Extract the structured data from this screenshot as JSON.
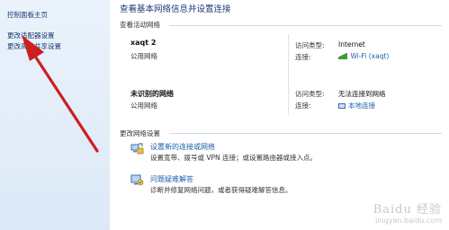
{
  "sidebar": {
    "links": [
      {
        "label": "控制面板主页"
      },
      {
        "label": "更改适配器设置"
      },
      {
        "label": "更改高级共享设置"
      }
    ]
  },
  "main": {
    "title": "查看基本网络信息并设置连接",
    "active_section_label": "查看活动网络",
    "networks": [
      {
        "name": "xaqt  2",
        "category": "公用网络",
        "access_type_label": "访问类型:",
        "access_type_value": "Internet",
        "connection_label": "连接:",
        "connection_value": "Wi-Fi (xaqt)"
      },
      {
        "name": "未识别的网络",
        "category": "公用网络",
        "access_type_label": "访问类型:",
        "access_type_value": "无法连接到网络",
        "connection_label": "连接:",
        "connection_value": "本地连接"
      }
    ],
    "change_section_label": "更改网络设置",
    "tasks": [
      {
        "link": "设置新的连接或网络",
        "description": "设置宽带、拨号或 VPN 连接；或设置路由器或接入点。"
      },
      {
        "link": "问题疑难解答",
        "description": "诊断并修复网络问题，或者获得疑难解答信息。"
      }
    ]
  },
  "watermark": {
    "top": "Baidu 经验",
    "bottom": "jingyan.baidu.com"
  },
  "colors": {
    "sidebar_bg": "#e3edf8",
    "link": "#1b5ea8",
    "title": "#1d3a72",
    "annotation_arrow": "#cc1f1f",
    "wifi_bars": "#3f9b3a"
  }
}
